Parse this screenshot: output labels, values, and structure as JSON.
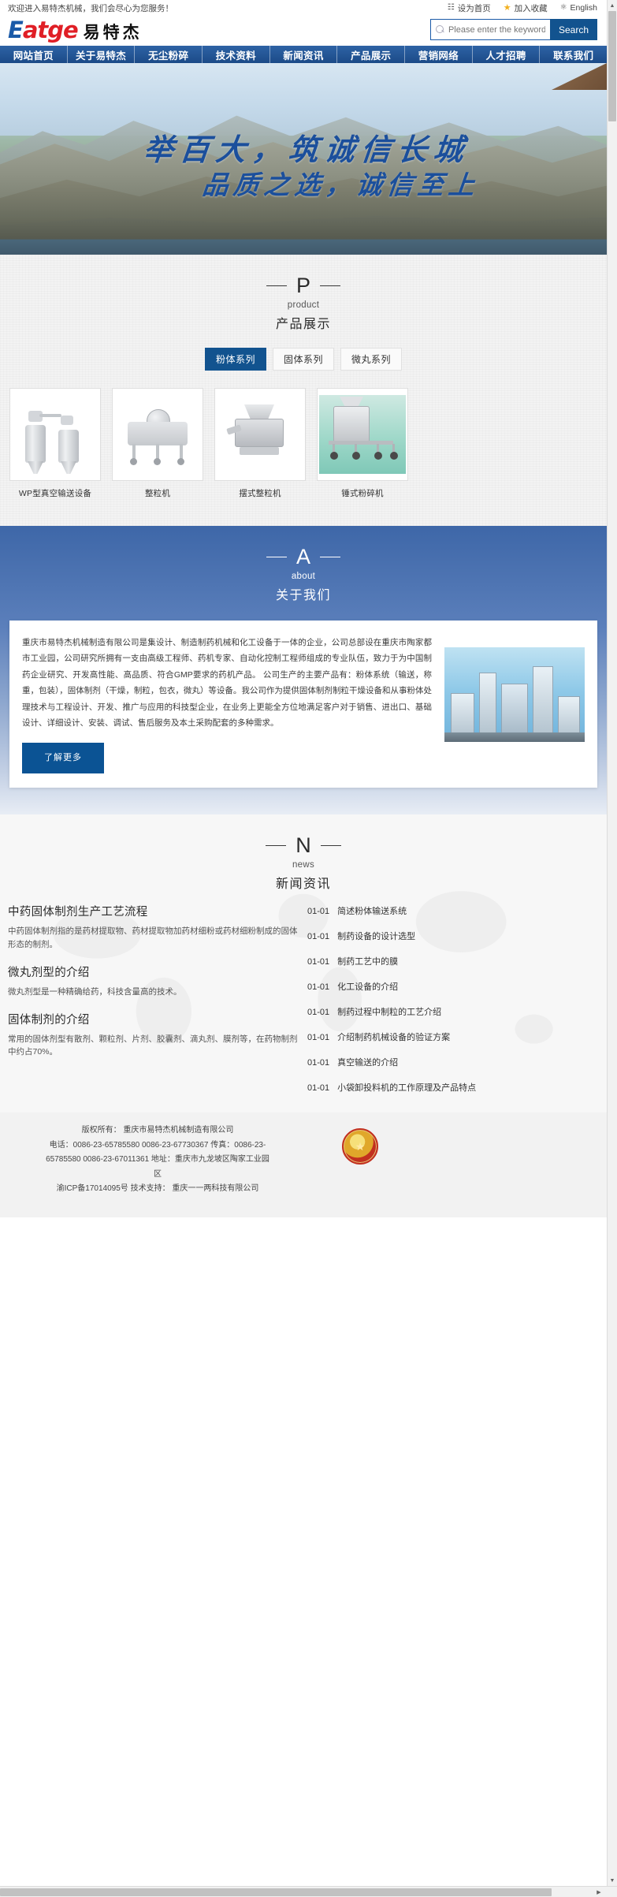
{
  "topbar": {
    "welcome": "欢迎进入易特杰机械，我们会尽心为您服务！",
    "tools": [
      {
        "icon": "home-icon",
        "label": "设为首页"
      },
      {
        "icon": "star-icon",
        "label": "加入收藏"
      },
      {
        "icon": "globe-icon",
        "label": "English"
      }
    ]
  },
  "header": {
    "logo_mark_first": "E",
    "logo_mark_rest": "atge",
    "logo_cn": "易特杰",
    "search": {
      "placeholder": "Please enter the keywords",
      "value": "",
      "button_label": "Search",
      "icon": "search-icon"
    }
  },
  "nav": {
    "items": [
      "网站首页",
      "关于易特杰",
      "无尘粉碎",
      "技术资料",
      "新闻资讯",
      "产品展示",
      "营销网络",
      "人才招聘",
      "联系我们"
    ]
  },
  "banner": {
    "slogan_line1": "举百大，筑诚信长城",
    "slogan_line2": "品质之选，诚信至上"
  },
  "product_section": {
    "letter": "P",
    "sub": "product",
    "cn": "产品展示",
    "tabs": [
      {
        "label": "粉体系列",
        "active": true
      },
      {
        "label": "固体系列",
        "active": false
      },
      {
        "label": "微丸系列",
        "active": false
      }
    ],
    "items": [
      {
        "name": "WP型真空输送设备",
        "image": "vacuum-conveyor-photo"
      },
      {
        "name": "整粒机",
        "image": "granulator-photo"
      },
      {
        "name": "摆式整粒机",
        "image": "swing-granulator-photo"
      },
      {
        "name": "锤式粉碎机",
        "image": "hammer-mill-photo"
      }
    ]
  },
  "about_section": {
    "letter": "A",
    "sub": "about",
    "cn": "关于我们",
    "text": "重庆市易特杰机械制造有限公司是集设计、制造制药机械和化工设备于一体的企业，公司总部设在重庆市陶家都市工业园，公司研究所拥有一支由高级工程师、药机专家、自动化控制工程师组成的专业队伍，致力于为中国制药企业研究、开发高性能、高品质、符合GMP要求的药机产品。 公司生产的主要产品有：粉体系统（输送，称重，包装），固体制剂（干燥，制粒，包衣，微丸）等设备。我公司作为提供固体制剂制粒干燥设备和从事粉体处理技术与工程设计、开发、推广与应用的科技型企业，在业务上更能全方位地满足客户对于销售、进出口、基础设计、详细设计、安装、调试、售后服务及本土采购配套的多种需求。",
    "more_label": "了解更多",
    "image": "city-buildings-photo"
  },
  "news_section": {
    "letter": "N",
    "sub": "news",
    "cn": "新闻资讯",
    "featured": [
      {
        "title": "中药固体制剂生产工艺流程",
        "desc": "中药固体制剂指的是药材提取物、药材提取物加药材细粉或药材细粉制成的固体形态的制剂。"
      },
      {
        "title": "微丸剂型的介绍",
        "desc": "微丸剂型是一种精确给药，科技含量高的技术。"
      },
      {
        "title": "固体制剂的介绍",
        "desc": "常用的固体剂型有散剂、颗粒剂、片剂、胶囊剂、滴丸剂、膜剂等，在药物制剂中约占70%。"
      }
    ],
    "links": [
      {
        "date": "01-01",
        "title": "简述粉体输送系统"
      },
      {
        "date": "01-01",
        "title": "制药设备的设计选型"
      },
      {
        "date": "01-01",
        "title": "制药工艺中的膜"
      },
      {
        "date": "01-01",
        "title": "化工设备的介绍"
      },
      {
        "date": "01-01",
        "title": "制药过程中制粒的工艺介绍"
      },
      {
        "date": "01-01",
        "title": "介绍制药机械设备的验证方案"
      },
      {
        "date": "01-01",
        "title": "真空输送的介绍"
      },
      {
        "date": "01-01",
        "title": "小袋卸投料机的工作原理及产品特点"
      }
    ]
  },
  "footer": {
    "line1": "版权所有：   重庆市易特杰机械制造有限公司",
    "line2": "电话：0086-23-65785580 0086-23-67730367 传真：0086-23-",
    "line3": "65785580 0086-23-67011361 地址：重庆市九龙坡区陶家工业园",
    "line4": "区",
    "line5": "渝ICP备17014095号 技术支持：  重庆一一两科技有限公司",
    "seal": "gov-seal-icon"
  },
  "colors": {
    "brand_blue": "#12538f",
    "nav_blue": "#1d4f8f",
    "logo_red": "#e01f26",
    "logo_blue": "#1a5aa8",
    "star_gold": "#f2b01e"
  }
}
